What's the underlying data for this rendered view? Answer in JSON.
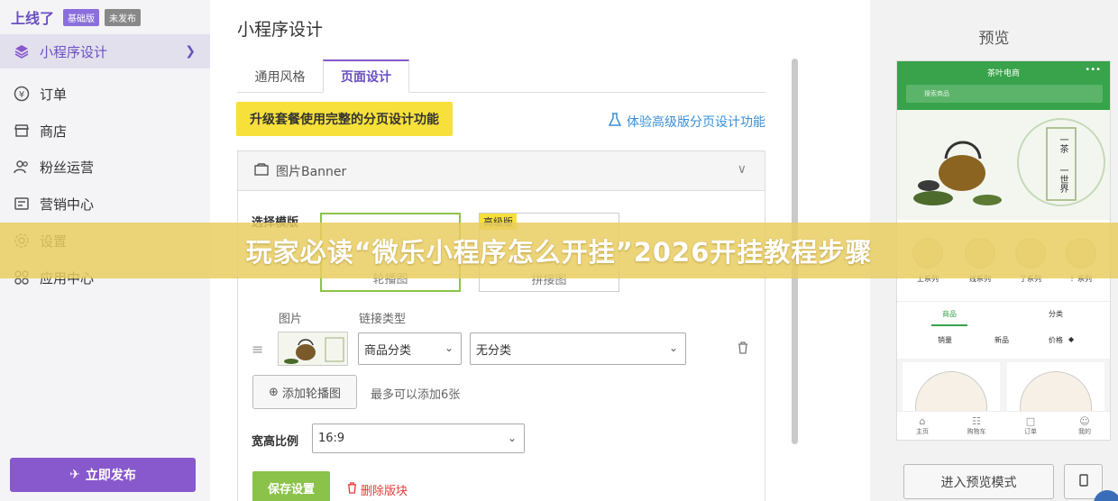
{
  "sidebar": {
    "brand": "上线了",
    "badge_plan": "基础版",
    "badge_status": "未发布",
    "items": [
      {
        "label": "小程序设计",
        "icon": "layers-icon"
      },
      {
        "label": "订单",
        "icon": "yen-circle-icon"
      },
      {
        "label": "商店",
        "icon": "store-icon"
      },
      {
        "label": "粉丝运营",
        "icon": "users-icon"
      },
      {
        "label": "营销中心",
        "icon": "marketing-icon"
      },
      {
        "label": "设置",
        "icon": "gear-icon"
      },
      {
        "label": "应用中心",
        "icon": "apps-icon"
      }
    ],
    "publish_label": "立即发布"
  },
  "main": {
    "title": "小程序设计",
    "tabs": [
      {
        "label": "通用风格"
      },
      {
        "label": "页面设计"
      }
    ],
    "upgrade_label": "升级套餐使用完整的分页设计功能",
    "trial_label": "体验高级版分页设计功能",
    "panel": {
      "title": "图片Banner",
      "choose_template_label": "选择模版",
      "templates": [
        {
          "caption": "轮播图"
        },
        {
          "caption": "拼接图",
          "tag": "高级版"
        }
      ],
      "col_image": "图片",
      "col_link_type": "链接类型",
      "link_type_value": "商品分类",
      "link_target_value": "无分类",
      "add_label": "添加轮播图",
      "hint": "最多可以添加6张",
      "aspect_label": "宽高比例",
      "aspect_value": "16:9",
      "save_label": "保存设置",
      "delete_label": "删除版块"
    }
  },
  "preview": {
    "title": "预览",
    "phone": {
      "title": "茶叶电商",
      "search_placeholder": "搜索商品",
      "banner_text_1": "一茶",
      "banner_text_2": "一世界",
      "categories": [
        {
          "label": "上系列"
        },
        {
          "label": "线系列"
        },
        {
          "label": "了系列"
        },
        {
          "label": "！系列"
        }
      ],
      "tabs": [
        {
          "label": "商品"
        },
        {
          "label": "分类"
        }
      ],
      "sort": [
        {
          "label": "销量"
        },
        {
          "label": "新品"
        },
        {
          "label": "价格"
        }
      ],
      "bottom_nav": [
        {
          "label": "主页"
        },
        {
          "label": "购物车"
        },
        {
          "label": "订单"
        },
        {
          "label": "我的"
        }
      ]
    },
    "enter_preview_label": "进入预览模式",
    "mobile_icon": "mobile-icon"
  },
  "overlay": {
    "text": "玩家必读“微乐小程序怎么开挂”2026开挂教程步骤"
  },
  "colors": {
    "brand_purple": "#8759cc",
    "upgrade_yellow": "#f7e03a",
    "save_green": "#8bc34a",
    "phone_green": "#38a34a",
    "delete_red": "#e53935",
    "overlay": "#e9cc60"
  }
}
